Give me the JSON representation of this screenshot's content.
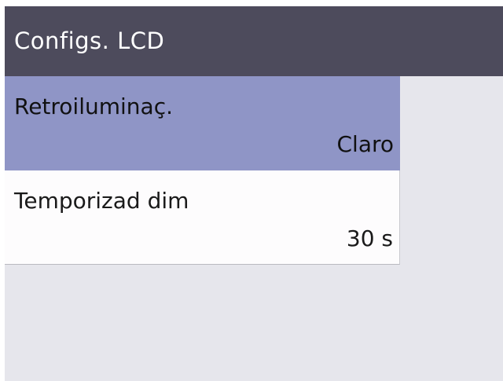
{
  "header": {
    "title": "Configs. LCD"
  },
  "menu": {
    "items": [
      {
        "label": "Retroiluminaç.",
        "value": "Claro",
        "selected": true
      },
      {
        "label": "Temporizad dim",
        "value": "30 s",
        "selected": false
      }
    ]
  },
  "colors": {
    "header_bg": "#4d4b5c",
    "selected_bg": "#8f95c6",
    "item_bg": "#fdfcfd",
    "screen_bg": "#e6e6ec"
  }
}
